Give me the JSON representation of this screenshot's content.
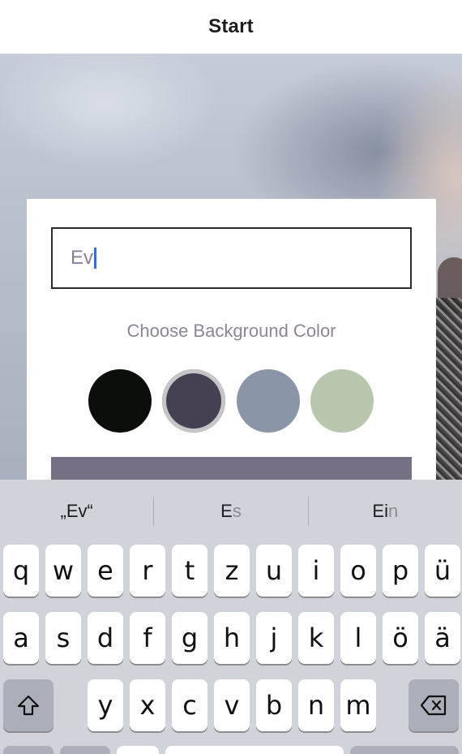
{
  "nav": {
    "title": "Start"
  },
  "form": {
    "name_value": "Ev",
    "background_label": "Choose Background Color",
    "colors": [
      "#0b0e0b",
      "#474053",
      "#8a95a8",
      "#b9c6ae"
    ],
    "selected_color_index": 1,
    "button_color": "#757083"
  },
  "keyboard": {
    "suggestions": [
      {
        "main": "„Ev“",
        "rest": ""
      },
      {
        "main": "E",
        "rest": "s"
      },
      {
        "main": "Ei",
        "rest": "n"
      }
    ],
    "rows": [
      [
        "q",
        "w",
        "e",
        "r",
        "t",
        "z",
        "u",
        "i",
        "o",
        "p",
        "ü"
      ],
      [
        "a",
        "s",
        "d",
        "f",
        "g",
        "h",
        "j",
        "k",
        "l",
        "ö",
        "ä"
      ],
      [
        "y",
        "x",
        "c",
        "v",
        "b",
        "n",
        "m"
      ]
    ],
    "icons": {
      "shift": "shift-icon",
      "delete": "delete-icon"
    }
  }
}
